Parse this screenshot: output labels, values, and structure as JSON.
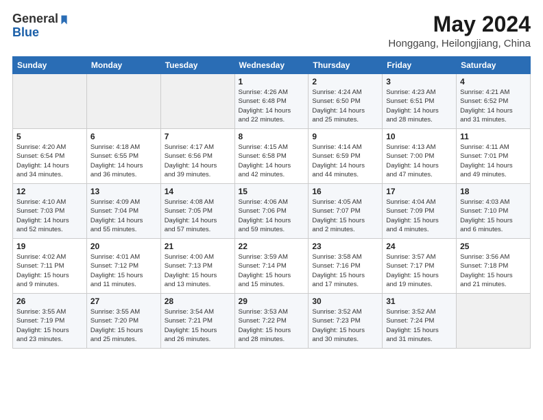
{
  "header": {
    "logo_general": "General",
    "logo_blue": "Blue",
    "month": "May 2024",
    "location": "Honggang, Heilongjiang, China"
  },
  "weekdays": [
    "Sunday",
    "Monday",
    "Tuesday",
    "Wednesday",
    "Thursday",
    "Friday",
    "Saturday"
  ],
  "weeks": [
    [
      {
        "day": "",
        "info": ""
      },
      {
        "day": "",
        "info": ""
      },
      {
        "day": "",
        "info": ""
      },
      {
        "day": "1",
        "info": "Sunrise: 4:26 AM\nSunset: 6:48 PM\nDaylight: 14 hours\nand 22 minutes."
      },
      {
        "day": "2",
        "info": "Sunrise: 4:24 AM\nSunset: 6:50 PM\nDaylight: 14 hours\nand 25 minutes."
      },
      {
        "day": "3",
        "info": "Sunrise: 4:23 AM\nSunset: 6:51 PM\nDaylight: 14 hours\nand 28 minutes."
      },
      {
        "day": "4",
        "info": "Sunrise: 4:21 AM\nSunset: 6:52 PM\nDaylight: 14 hours\nand 31 minutes."
      }
    ],
    [
      {
        "day": "5",
        "info": "Sunrise: 4:20 AM\nSunset: 6:54 PM\nDaylight: 14 hours\nand 34 minutes."
      },
      {
        "day": "6",
        "info": "Sunrise: 4:18 AM\nSunset: 6:55 PM\nDaylight: 14 hours\nand 36 minutes."
      },
      {
        "day": "7",
        "info": "Sunrise: 4:17 AM\nSunset: 6:56 PM\nDaylight: 14 hours\nand 39 minutes."
      },
      {
        "day": "8",
        "info": "Sunrise: 4:15 AM\nSunset: 6:58 PM\nDaylight: 14 hours\nand 42 minutes."
      },
      {
        "day": "9",
        "info": "Sunrise: 4:14 AM\nSunset: 6:59 PM\nDaylight: 14 hours\nand 44 minutes."
      },
      {
        "day": "10",
        "info": "Sunrise: 4:13 AM\nSunset: 7:00 PM\nDaylight: 14 hours\nand 47 minutes."
      },
      {
        "day": "11",
        "info": "Sunrise: 4:11 AM\nSunset: 7:01 PM\nDaylight: 14 hours\nand 49 minutes."
      }
    ],
    [
      {
        "day": "12",
        "info": "Sunrise: 4:10 AM\nSunset: 7:03 PM\nDaylight: 14 hours\nand 52 minutes."
      },
      {
        "day": "13",
        "info": "Sunrise: 4:09 AM\nSunset: 7:04 PM\nDaylight: 14 hours\nand 55 minutes."
      },
      {
        "day": "14",
        "info": "Sunrise: 4:08 AM\nSunset: 7:05 PM\nDaylight: 14 hours\nand 57 minutes."
      },
      {
        "day": "15",
        "info": "Sunrise: 4:06 AM\nSunset: 7:06 PM\nDaylight: 14 hours\nand 59 minutes."
      },
      {
        "day": "16",
        "info": "Sunrise: 4:05 AM\nSunset: 7:07 PM\nDaylight: 15 hours\nand 2 minutes."
      },
      {
        "day": "17",
        "info": "Sunrise: 4:04 AM\nSunset: 7:09 PM\nDaylight: 15 hours\nand 4 minutes."
      },
      {
        "day": "18",
        "info": "Sunrise: 4:03 AM\nSunset: 7:10 PM\nDaylight: 15 hours\nand 6 minutes."
      }
    ],
    [
      {
        "day": "19",
        "info": "Sunrise: 4:02 AM\nSunset: 7:11 PM\nDaylight: 15 hours\nand 9 minutes."
      },
      {
        "day": "20",
        "info": "Sunrise: 4:01 AM\nSunset: 7:12 PM\nDaylight: 15 hours\nand 11 minutes."
      },
      {
        "day": "21",
        "info": "Sunrise: 4:00 AM\nSunset: 7:13 PM\nDaylight: 15 hours\nand 13 minutes."
      },
      {
        "day": "22",
        "info": "Sunrise: 3:59 AM\nSunset: 7:14 PM\nDaylight: 15 hours\nand 15 minutes."
      },
      {
        "day": "23",
        "info": "Sunrise: 3:58 AM\nSunset: 7:16 PM\nDaylight: 15 hours\nand 17 minutes."
      },
      {
        "day": "24",
        "info": "Sunrise: 3:57 AM\nSunset: 7:17 PM\nDaylight: 15 hours\nand 19 minutes."
      },
      {
        "day": "25",
        "info": "Sunrise: 3:56 AM\nSunset: 7:18 PM\nDaylight: 15 hours\nand 21 minutes."
      }
    ],
    [
      {
        "day": "26",
        "info": "Sunrise: 3:55 AM\nSunset: 7:19 PM\nDaylight: 15 hours\nand 23 minutes."
      },
      {
        "day": "27",
        "info": "Sunrise: 3:55 AM\nSunset: 7:20 PM\nDaylight: 15 hours\nand 25 minutes."
      },
      {
        "day": "28",
        "info": "Sunrise: 3:54 AM\nSunset: 7:21 PM\nDaylight: 15 hours\nand 26 minutes."
      },
      {
        "day": "29",
        "info": "Sunrise: 3:53 AM\nSunset: 7:22 PM\nDaylight: 15 hours\nand 28 minutes."
      },
      {
        "day": "30",
        "info": "Sunrise: 3:52 AM\nSunset: 7:23 PM\nDaylight: 15 hours\nand 30 minutes."
      },
      {
        "day": "31",
        "info": "Sunrise: 3:52 AM\nSunset: 7:24 PM\nDaylight: 15 hours\nand 31 minutes."
      },
      {
        "day": "",
        "info": ""
      }
    ]
  ]
}
